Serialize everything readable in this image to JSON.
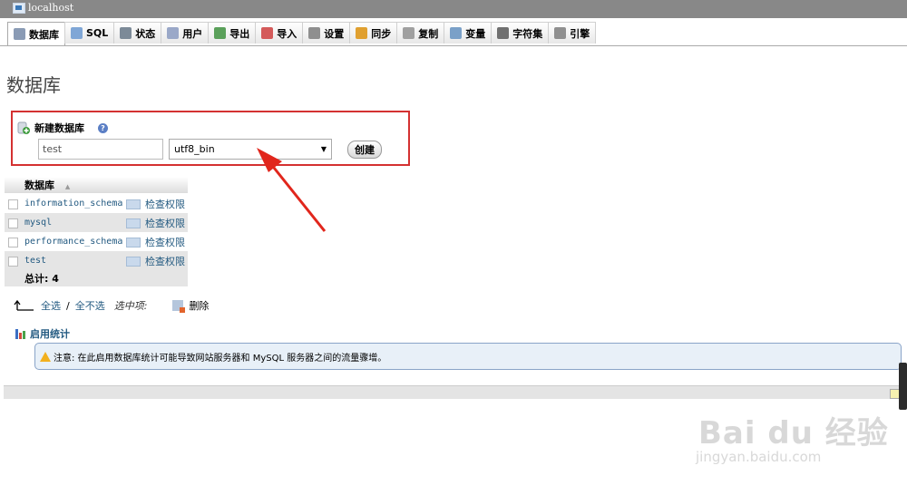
{
  "topbar": {
    "server": "localhost"
  },
  "tabs": [
    {
      "label": "数据库",
      "icon": "database-icon",
      "color": "#8a9bb5",
      "active": true
    },
    {
      "label": "SQL",
      "icon": "sql-icon",
      "color": "#7fa6d6"
    },
    {
      "label": "状态",
      "icon": "status-icon",
      "color": "#7c8a98"
    },
    {
      "label": "用户",
      "icon": "users-icon",
      "color": "#9aa8c8"
    },
    {
      "label": "导出",
      "icon": "export-icon",
      "color": "#5aa05a"
    },
    {
      "label": "导入",
      "icon": "import-icon",
      "color": "#d45a5a"
    },
    {
      "label": "设置",
      "icon": "settings-wrench-icon",
      "color": "#8f8f8f"
    },
    {
      "label": "同步",
      "icon": "sync-icon",
      "color": "#e0a030"
    },
    {
      "label": "复制",
      "icon": "replication-icon",
      "color": "#a0a0a0"
    },
    {
      "label": "变量",
      "icon": "variables-icon",
      "color": "#7aa0c8"
    },
    {
      "label": "字符集",
      "icon": "charset-icon",
      "color": "#707070"
    },
    {
      "label": "引擎",
      "icon": "engines-icon",
      "color": "#8f8f8f"
    }
  ],
  "page_title": "数据库",
  "create_db": {
    "title": "新建数据库",
    "name_value": "test",
    "collation_value": "utf8_bin",
    "create_label": "创建",
    "help_icon": "?"
  },
  "db_table": {
    "header": "数据库",
    "sort_icon": "▲",
    "check_privileges": "检查权限",
    "rows": [
      {
        "name": "information_schema"
      },
      {
        "name": "mysql"
      },
      {
        "name": "performance_schema"
      },
      {
        "name": "test"
      }
    ],
    "total_label": "总计: 4"
  },
  "bulk": {
    "select_all": "全选",
    "separator": "/",
    "select_none": "全不选",
    "with_selected": "选中项:",
    "drop_label": "删除"
  },
  "stats": {
    "enable_label": "启用统计",
    "notice": "注意: 在此启用数据库统计可能导致网站服务器和 MySQL 服务器之间的流量骤增。"
  },
  "watermark": {
    "brand": "Bai du 经验",
    "url": "jingyan.baidu.com"
  },
  "colors": {
    "highlight_border": "#d43131",
    "link": "#235a81",
    "notice_bg": "#e8f0f8"
  }
}
